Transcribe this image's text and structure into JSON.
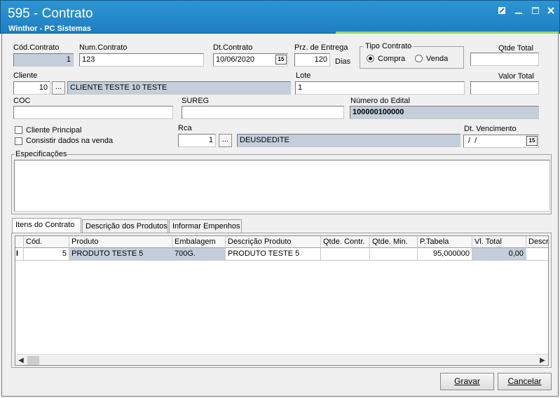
{
  "window": {
    "title": "595 - Contrato",
    "subtitle": "Winthor - PC Sistemas",
    "controls": [
      "restore-icon",
      "minimize-icon",
      "maximize-icon",
      "close-icon"
    ]
  },
  "form": {
    "cod_contrato": {
      "label": "Cód.Contrato",
      "value": "1"
    },
    "num_contrato": {
      "label": "Num.Contrato",
      "value": "123"
    },
    "dt_contrato": {
      "label": "Dt.Contrato",
      "value": "10/06/2020"
    },
    "prz_entrega": {
      "label": "Prz. de Entrega",
      "value": "120",
      "unit": "Dias"
    },
    "tipo_contrato": {
      "label": "Tipo Contrato",
      "options": [
        "Compra",
        "Venda"
      ],
      "selected": "Compra"
    },
    "qtde_total": {
      "label": "Qtde Total",
      "value": ""
    },
    "cliente": {
      "label": "Cliente",
      "code": "10",
      "name": "CLIENTE TESTE 10 TESTE"
    },
    "lote": {
      "label": "Lote",
      "value": "1"
    },
    "valor_total": {
      "label": "Valor Total",
      "value": ""
    },
    "coc": {
      "label": "COC",
      "value": ""
    },
    "sureg": {
      "label": "SUREG",
      "value": ""
    },
    "numero_edital": {
      "label": "Número do Edital",
      "value": "100000100000"
    },
    "cliente_principal": {
      "label": "Cliente Principal",
      "checked": false
    },
    "consistir": {
      "label": "Consistir dados na venda",
      "checked": false
    },
    "rca": {
      "label": "Rca",
      "code": "1",
      "name": "DEUSDEDITE"
    },
    "dt_vencimento": {
      "label": "Dt. Vencimento",
      "value": " /  /"
    },
    "especificacoes": {
      "label": "Especificações",
      "value": ""
    },
    "dots_label": "...",
    "cal_label": "15"
  },
  "tabs": [
    {
      "label": "Itens do Contrato",
      "active": true
    },
    {
      "label": "Descrição dos Produtos",
      "active": false
    },
    {
      "label": "Informar Empenhos",
      "active": false
    }
  ],
  "grid": {
    "columns": [
      "Cód.",
      "Produto",
      "Embalagem",
      "Descrição Produto",
      "Qtde. Contr.",
      "Qtde. Min.",
      "P.Tabela",
      "Vl. Total",
      "Descri"
    ],
    "rows": [
      {
        "indicator": "I",
        "cells": [
          "5",
          "PRODUTO TESTE 5",
          "700G.",
          "PRODUTO TESTE 5",
          "",
          "",
          "95,000000",
          "0,00",
          ""
        ]
      }
    ]
  },
  "buttons": {
    "save": "Gravar",
    "cancel": "Cancelar"
  }
}
